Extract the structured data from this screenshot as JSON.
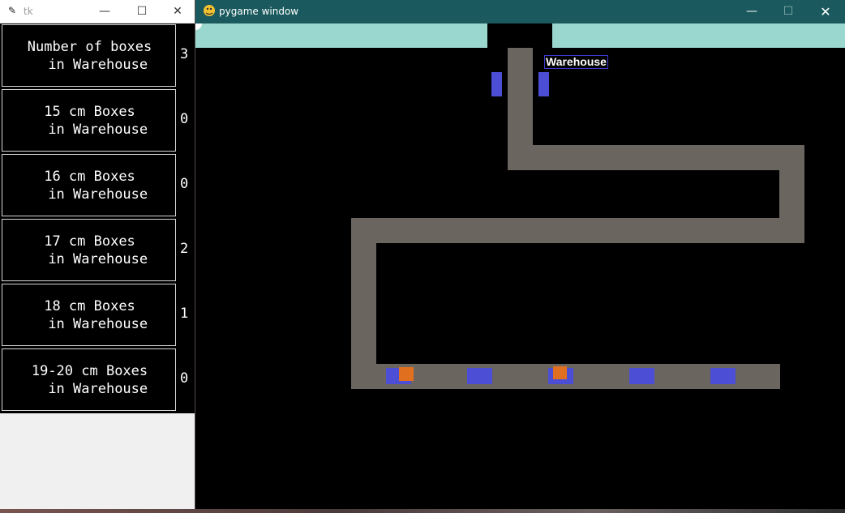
{
  "tk_window": {
    "title": "tk",
    "app_icon": "feather-icon",
    "rows": [
      {
        "label": "Number of boxes\n  in Warehouse",
        "value": "3"
      },
      {
        "label": "15 cm Boxes\n  in Warehouse",
        "value": "0"
      },
      {
        "label": "16 cm Boxes\n  in Warehouse",
        "value": "0"
      },
      {
        "label": "17 cm Boxes\n  in Warehouse",
        "value": "2"
      },
      {
        "label": "18 cm Boxes\n  in Warehouse",
        "value": "1"
      },
      {
        "label": "19-20 cm Boxes\n  in Warehouse",
        "value": "0"
      }
    ]
  },
  "pygame_window": {
    "title": "pygame window",
    "app_icon": "snake-icon",
    "warehouse_label": "Warehouse"
  },
  "window_controls": {
    "minimize": "—",
    "maximize": "☐",
    "close": "✕"
  },
  "colors": {
    "belt": "#6b6560",
    "box": "#4c4fd6",
    "item": "#e07020",
    "top_strip": "#9ad8cf",
    "pygame_titlebar": "#1a5a5e"
  }
}
